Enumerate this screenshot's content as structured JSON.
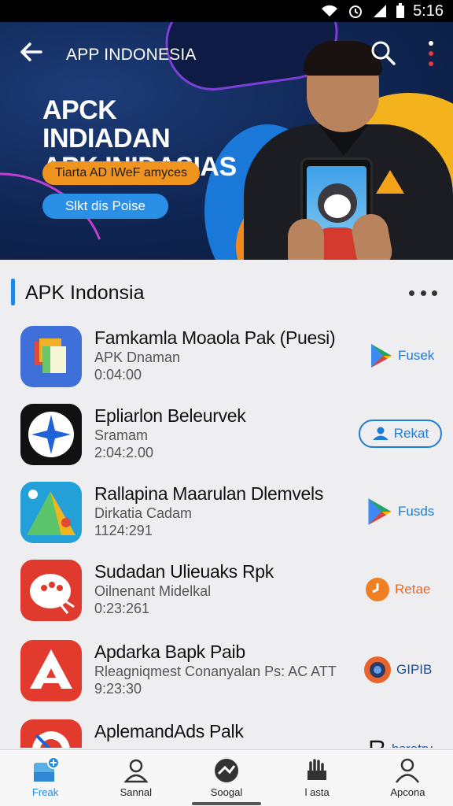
{
  "status_bar": {
    "time": "5:16",
    "icons": [
      "wifi-icon",
      "alarm-icon",
      "signal-icon",
      "battery-icon"
    ]
  },
  "app_bar": {
    "title": "APP INDONESIA",
    "back_icon": "arrow-left-icon",
    "search_icon": "search-icon",
    "menu_icon": "more-vertical-icon"
  },
  "banner": {
    "headline_line1": "APCK INDIADAN",
    "headline_line2": "APK INIDASIAS",
    "cta_primary": "Tiarta AD IWeF amyces",
    "cta_secondary": "Slkt dis Poise"
  },
  "section": {
    "title": "APK Indonsia",
    "more_icon": "more-horizontal-icon"
  },
  "apps": [
    {
      "name": "Famkamla Moaola Pak (Puesi)",
      "subtitle": "APK Dnaman",
      "meta": "0:04:00",
      "action_label": "Fusek",
      "action_icon": "play-store-icon"
    },
    {
      "name": "Epliarlon Beleurvek",
      "subtitle": "Sramam",
      "meta": "2:04:2.00",
      "action_label": "Rekat",
      "action_icon": "person-icon"
    },
    {
      "name": "Rallapina Maarulan Dlemvels",
      "subtitle": "Dirkatia Cadam",
      "meta": "1124:291",
      "action_label": "Fusds",
      "action_icon": "play-store-icon"
    },
    {
      "name": "Sudadan Ulieuaks Rpk",
      "subtitle": "Oilnenant Midelkal",
      "meta": "0:23:261",
      "action_label": "Retae",
      "action_icon": "clock-icon"
    },
    {
      "name": "Apdarka Bapk Paib",
      "subtitle": "Rleagniqmest Conanyalan Ps: AC ATT",
      "meta": "9:23:30",
      "action_label": "GIPIB",
      "action_icon": "lens-icon"
    },
    {
      "name": "AplemandAds Palk",
      "subtitle": "",
      "meta": "",
      "action_label": "bsrotry",
      "action_icon": "b-icon"
    }
  ],
  "bottom_nav": [
    {
      "label": "Freak",
      "icon": "home-plus-icon",
      "active": true
    },
    {
      "label": "Sannal",
      "icon": "user-icon",
      "active": false
    },
    {
      "label": "Soogal",
      "icon": "gauge-icon",
      "active": false
    },
    {
      "label": "l asta",
      "icon": "hand-icon",
      "active": false
    },
    {
      "label": "Apcona",
      "icon": "account-icon",
      "active": false
    }
  ],
  "colors": {
    "accent": "#1e88e5",
    "orange": "#f09420",
    "banner_bg": "#0f2552"
  }
}
